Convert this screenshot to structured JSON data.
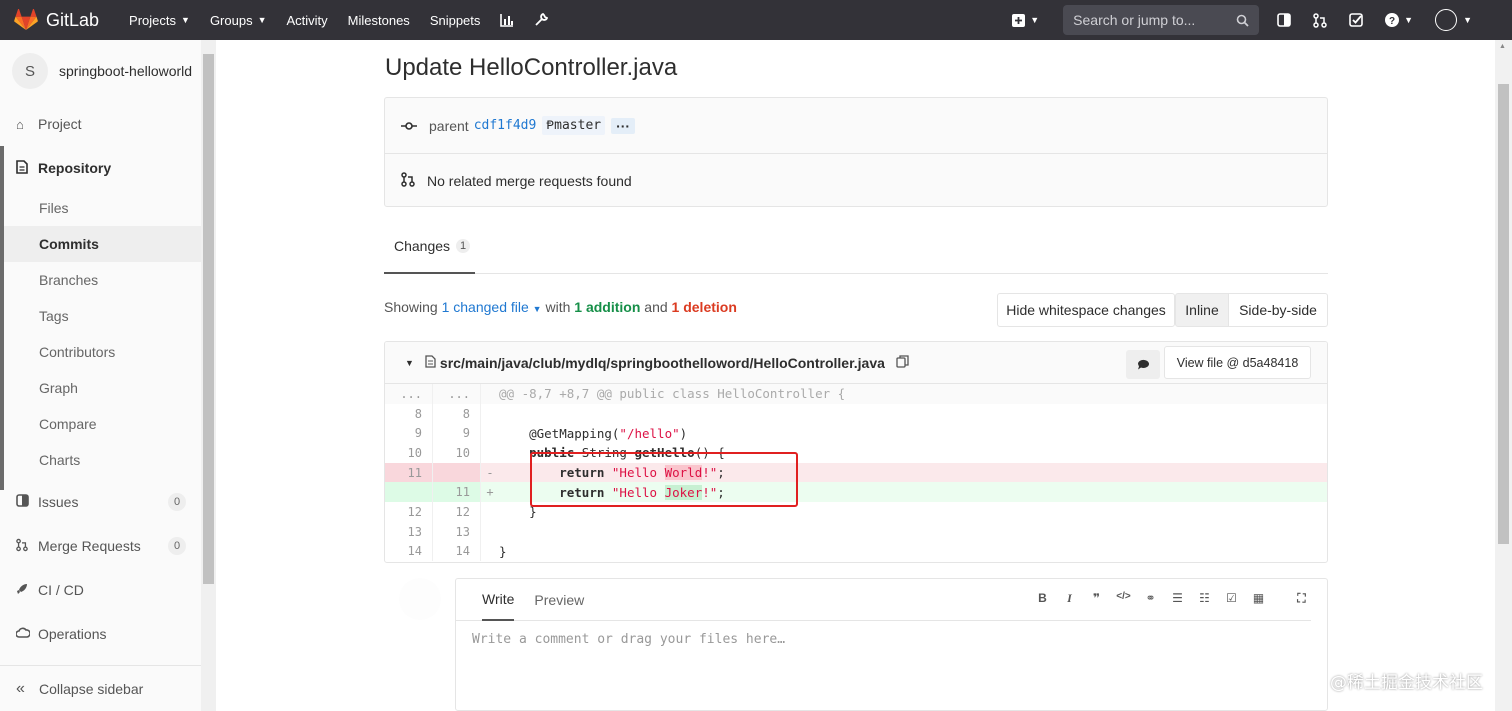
{
  "topbar": {
    "brand": "GitLab",
    "nav": [
      "Projects",
      "Groups",
      "Activity",
      "Milestones",
      "Snippets"
    ],
    "search_placeholder": "Search or jump to..."
  },
  "sidebar": {
    "project_initial": "S",
    "project_name": "springboot-helloworld",
    "project": "Project",
    "repository": "Repository",
    "repo_items": [
      "Files",
      "Commits",
      "Branches",
      "Tags",
      "Contributors",
      "Graph",
      "Compare",
      "Charts"
    ],
    "issues": "Issues",
    "issues_count": "0",
    "merge_requests": "Merge Requests",
    "mr_count": "0",
    "cicd": "CI / CD",
    "operations": "Operations",
    "collapse": "Collapse sidebar"
  },
  "commit": {
    "title": "Update HelloController.java",
    "parent_label": "parent",
    "parent_sha": "cdf1f4d9",
    "branch": "master",
    "dots": "···",
    "no_mr": "No related merge requests found"
  },
  "changes": {
    "tab_label": "Changes",
    "tab_count": "1",
    "showing": "Showing",
    "changed_file": "1 changed file",
    "with": "with",
    "additions": "1 addition",
    "and": "and",
    "deletions": "1 deletion",
    "hide_ws": "Hide whitespace changes",
    "inline": "Inline",
    "side": "Side-by-side"
  },
  "file": {
    "path": "src/main/java/club/mydlq/springboothelloword/HelloController.java",
    "view_file": "View file @ d5a48418",
    "hunk": "@@ -8,7 +8,7 @@ public class HelloController {",
    "dots": "...",
    "lines": [
      {
        "old": "8",
        "new": "8",
        "sign": "",
        "code": ""
      },
      {
        "old": "9",
        "new": "9",
        "sign": "",
        "code": "    @GetMapping(\"/hello\")"
      },
      {
        "old": "10",
        "new": "10",
        "sign": "",
        "code": "    public String getHello() {"
      },
      {
        "old": "11",
        "new": "",
        "sign": "-",
        "code": "        return \"Hello World!\";"
      },
      {
        "old": "",
        "new": "11",
        "sign": "+",
        "code": "        return \"Hello Joker!\";"
      },
      {
        "old": "12",
        "new": "12",
        "sign": "",
        "code": "    }"
      },
      {
        "old": "13",
        "new": "13",
        "sign": "",
        "code": ""
      },
      {
        "old": "14",
        "new": "14",
        "sign": "",
        "code": "}"
      }
    ]
  },
  "comment": {
    "write": "Write",
    "preview": "Preview",
    "placeholder": "Write a comment or drag your files here…"
  },
  "watermark": "@稀土掘金技术社区"
}
